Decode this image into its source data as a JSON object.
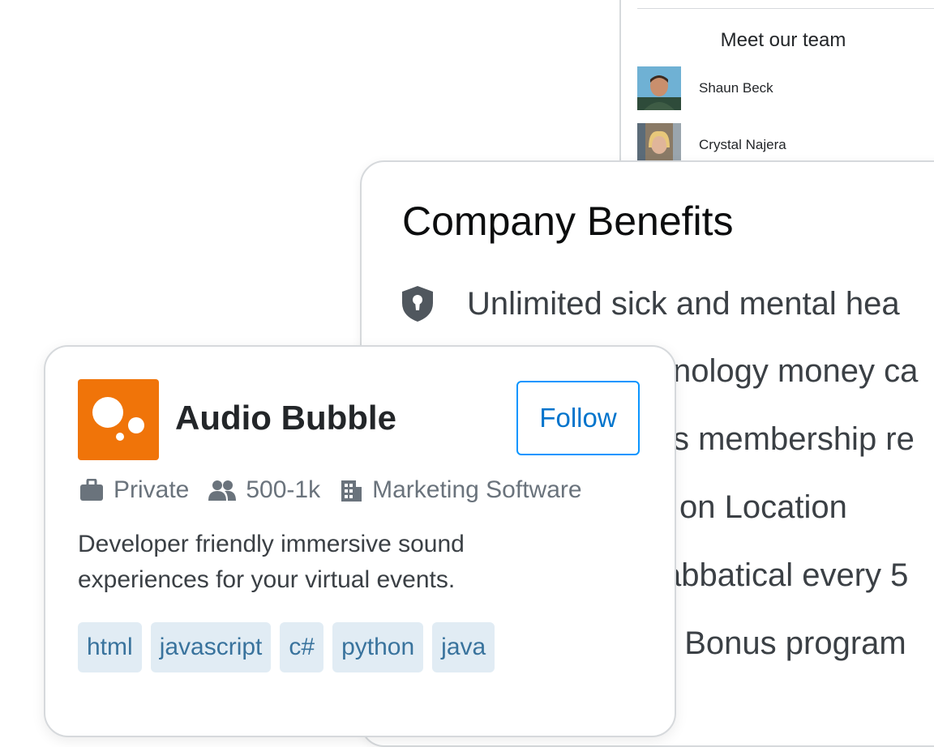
{
  "team": {
    "title": "Meet our team",
    "members": [
      {
        "name": "Shaun Beck"
      },
      {
        "name": "Crystal Najera"
      }
    ]
  },
  "benefits": {
    "title": "Company Benefits",
    "icon": "shield-keyhole-icon",
    "items": [
      "Unlimited sick and mental hea",
      "nology money ca",
      "s membership re",
      "on Location",
      "abbatical every 5",
      ". Bonus program"
    ]
  },
  "company": {
    "name": "Audio Bubble",
    "follow_label": "Follow",
    "type": "Private",
    "size": "500-1k",
    "industry": "Marketing Software",
    "description_line1": "Developer friendly immersive sound",
    "description_line2": "experiences for your virtual events.",
    "tags": [
      "html",
      "javascript",
      "c#",
      "python",
      "java"
    ],
    "logo_color": "#f07409",
    "accent_color": "#0a95ff"
  }
}
